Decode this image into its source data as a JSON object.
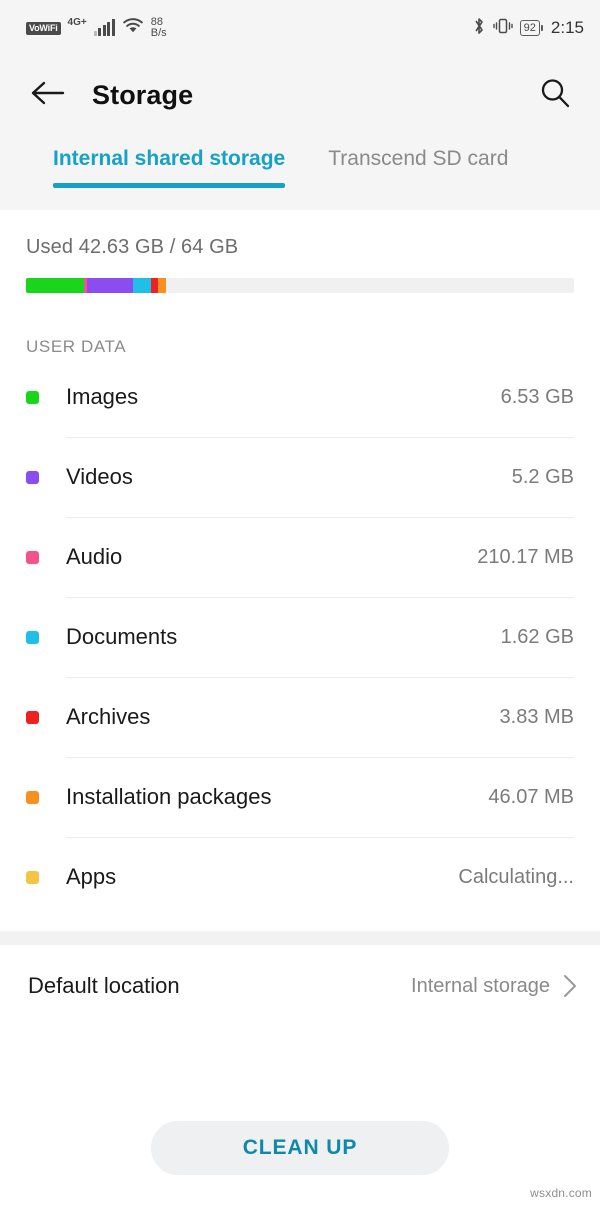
{
  "status_bar": {
    "vowifi_label": "VoWiFi",
    "network_type": "4G+",
    "wifi_icon": "wifi-icon",
    "net_speed_value": "88",
    "net_speed_unit": "B/s",
    "bluetooth_icon": "bluetooth-icon",
    "vibrate_icon": "vibrate-icon",
    "battery_level": "92",
    "time": "2:15"
  },
  "app_bar": {
    "back_icon": "back-arrow-icon",
    "title": "Storage",
    "search_icon": "search-icon"
  },
  "tabs": [
    {
      "label": "Internal shared storage",
      "active": true
    },
    {
      "label": "Transcend SD card",
      "active": false
    }
  ],
  "usage": {
    "summary_text": "Used 42.63 GB / 64 GB",
    "used": "42.63 GB",
    "total": "64 GB",
    "segments": [
      {
        "name": "Images",
        "color": "#1ad61a",
        "percent": 10.6
      },
      {
        "name": "Audio",
        "color": "#f6518c",
        "percent": 0.6
      },
      {
        "name": "Videos",
        "color": "#8b4df0",
        "percent": 8.4
      },
      {
        "name": "Documents",
        "color": "#1fc0e6",
        "percent": 3.2
      },
      {
        "name": "Archives",
        "color": "#ef2020",
        "percent": 1.3
      },
      {
        "name": "Installation packages",
        "color": "#f79020",
        "percent": 1.5
      }
    ],
    "track_color": "#f0f0f0"
  },
  "section": {
    "label": "USER DATA"
  },
  "items": [
    {
      "label": "Images",
      "value": "6.53 GB",
      "color": "#1ad61a"
    },
    {
      "label": "Videos",
      "value": "5.2 GB",
      "color": "#8b4df0"
    },
    {
      "label": "Audio",
      "value": "210.17 MB",
      "color": "#f6518c"
    },
    {
      "label": "Documents",
      "value": "1.62 GB",
      "color": "#1fc0e6"
    },
    {
      "label": "Archives",
      "value": "3.83 MB",
      "color": "#ef2020"
    },
    {
      "label": "Installation packages",
      "value": "46.07 MB",
      "color": "#f79020"
    },
    {
      "label": "Apps",
      "value": "Calculating...",
      "color": "#f5c542"
    }
  ],
  "default_location": {
    "label": "Default location",
    "value": "Internal storage",
    "chevron_icon": "chevron-right-icon"
  },
  "cleanup": {
    "label": "CLEAN UP"
  },
  "watermark": {
    "text": "wsxdn.com"
  },
  "colors": {
    "accent": "#16a2c4",
    "cleanup_text": "#1089a8",
    "header_bg": "#f5f5f6",
    "divider": "#ededed"
  }
}
